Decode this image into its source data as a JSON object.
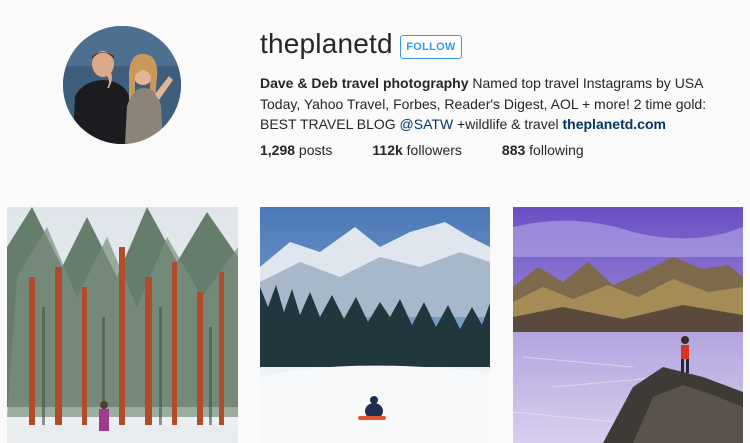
{
  "profile": {
    "username": "theplanetd",
    "follow_label": "FOLLOW",
    "bio_name": "Dave & Deb travel photography",
    "bio_part1": " Named top travel Instagrams by USA Today, Yahoo Travel, Forbes, Reader's Digest, AOL + more! 2 time gold: BEST TRAVEL BLOG ",
    "bio_mention": "@SATW",
    "bio_part2": " +wildlife & travel ",
    "bio_link": "theplanetd.com"
  },
  "stats": {
    "posts_count": "1,298",
    "posts_label": " posts",
    "followers_count": "112k",
    "followers_label": " followers",
    "following_count": "883",
    "following_label": " following"
  },
  "colors": {
    "accent": "#3897f0",
    "link": "#003569",
    "background": "#fafafa"
  }
}
